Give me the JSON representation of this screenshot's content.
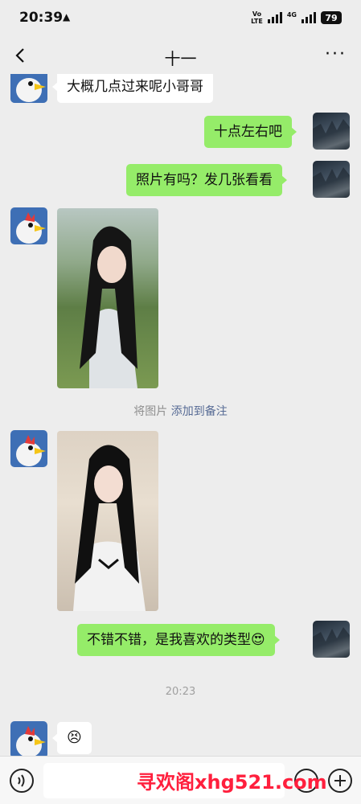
{
  "status_bar": {
    "time": "20:39",
    "volte_top": "Vo",
    "volte_bottom": "LTE",
    "network": "4G",
    "battery": "79"
  },
  "header": {
    "title": "十一",
    "more": "···"
  },
  "messages": {
    "m1": "大概几点过来呢小哥哥",
    "m2": "十点左右吧",
    "m3": "照片有吗？发几张看看",
    "m4": "不错不错，是我喜欢的类型",
    "m4_emoji": "😍",
    "m5_emoji": "😣"
  },
  "system_note": {
    "prefix": "将图片 ",
    "link": "添加到备注"
  },
  "timestamp": "20:23",
  "watermark": "寻欢阁xhg521.com",
  "colors": {
    "background": "#ededed",
    "outgoing_bubble": "#95ec69",
    "incoming_bubble": "#ffffff",
    "link": "#576b95",
    "watermark": "#ff1f3d"
  }
}
